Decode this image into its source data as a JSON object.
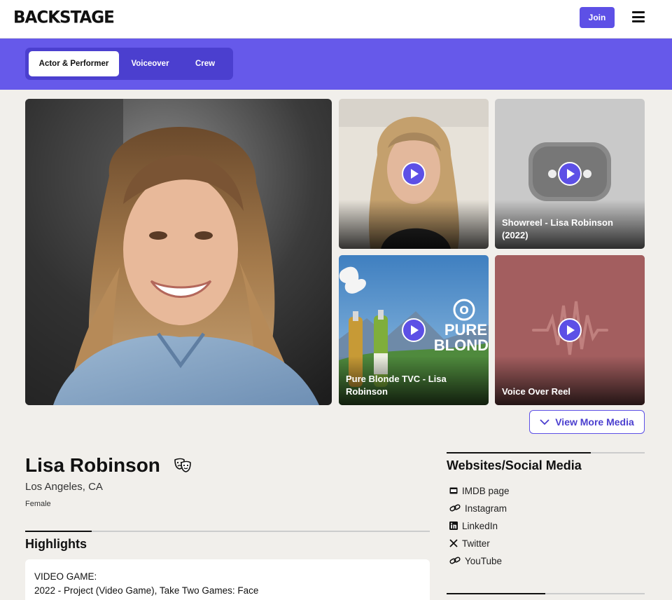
{
  "header": {
    "logo": "BACKSTAGE",
    "join_label": "Join"
  },
  "role_tabs": [
    "Actor & Performer",
    "Voiceover",
    "Crew"
  ],
  "media": {
    "tiles": [
      {
        "caption": ""
      },
      {
        "caption": "Showreel - Lisa Robinson (2022)"
      },
      {
        "caption": "Pure Blonde TVC - Lisa Robinson"
      },
      {
        "caption": "Voice Over Reel"
      }
    ],
    "pure_blonde_text": [
      "PURE",
      "BLOND"
    ],
    "view_more_label": "View More Media"
  },
  "profile": {
    "name": "Lisa Robinson",
    "location": "Los Angeles, CA",
    "gender": "Female"
  },
  "highlights": {
    "title": "Highlights",
    "lines": [
      "VIDEO GAME:",
      "2022 - Project (Video Game), Take Two Games: Face"
    ]
  },
  "websites": {
    "title": "Websites/Social Media",
    "links": [
      {
        "label": "IMDB page",
        "icon": "imdb-icon"
      },
      {
        "label": "Instagram",
        "icon": "link-icon"
      },
      {
        "label": "LinkedIn",
        "icon": "linkedin-icon"
      },
      {
        "label": "Twitter",
        "icon": "x-icon"
      },
      {
        "label": "YouTube",
        "icon": "link-icon"
      }
    ]
  },
  "colors": {
    "brand": "#5d50e6",
    "band": "#6659ea",
    "tabs_bg": "#4b3fcf",
    "page_bg": "#f1efeb"
  }
}
